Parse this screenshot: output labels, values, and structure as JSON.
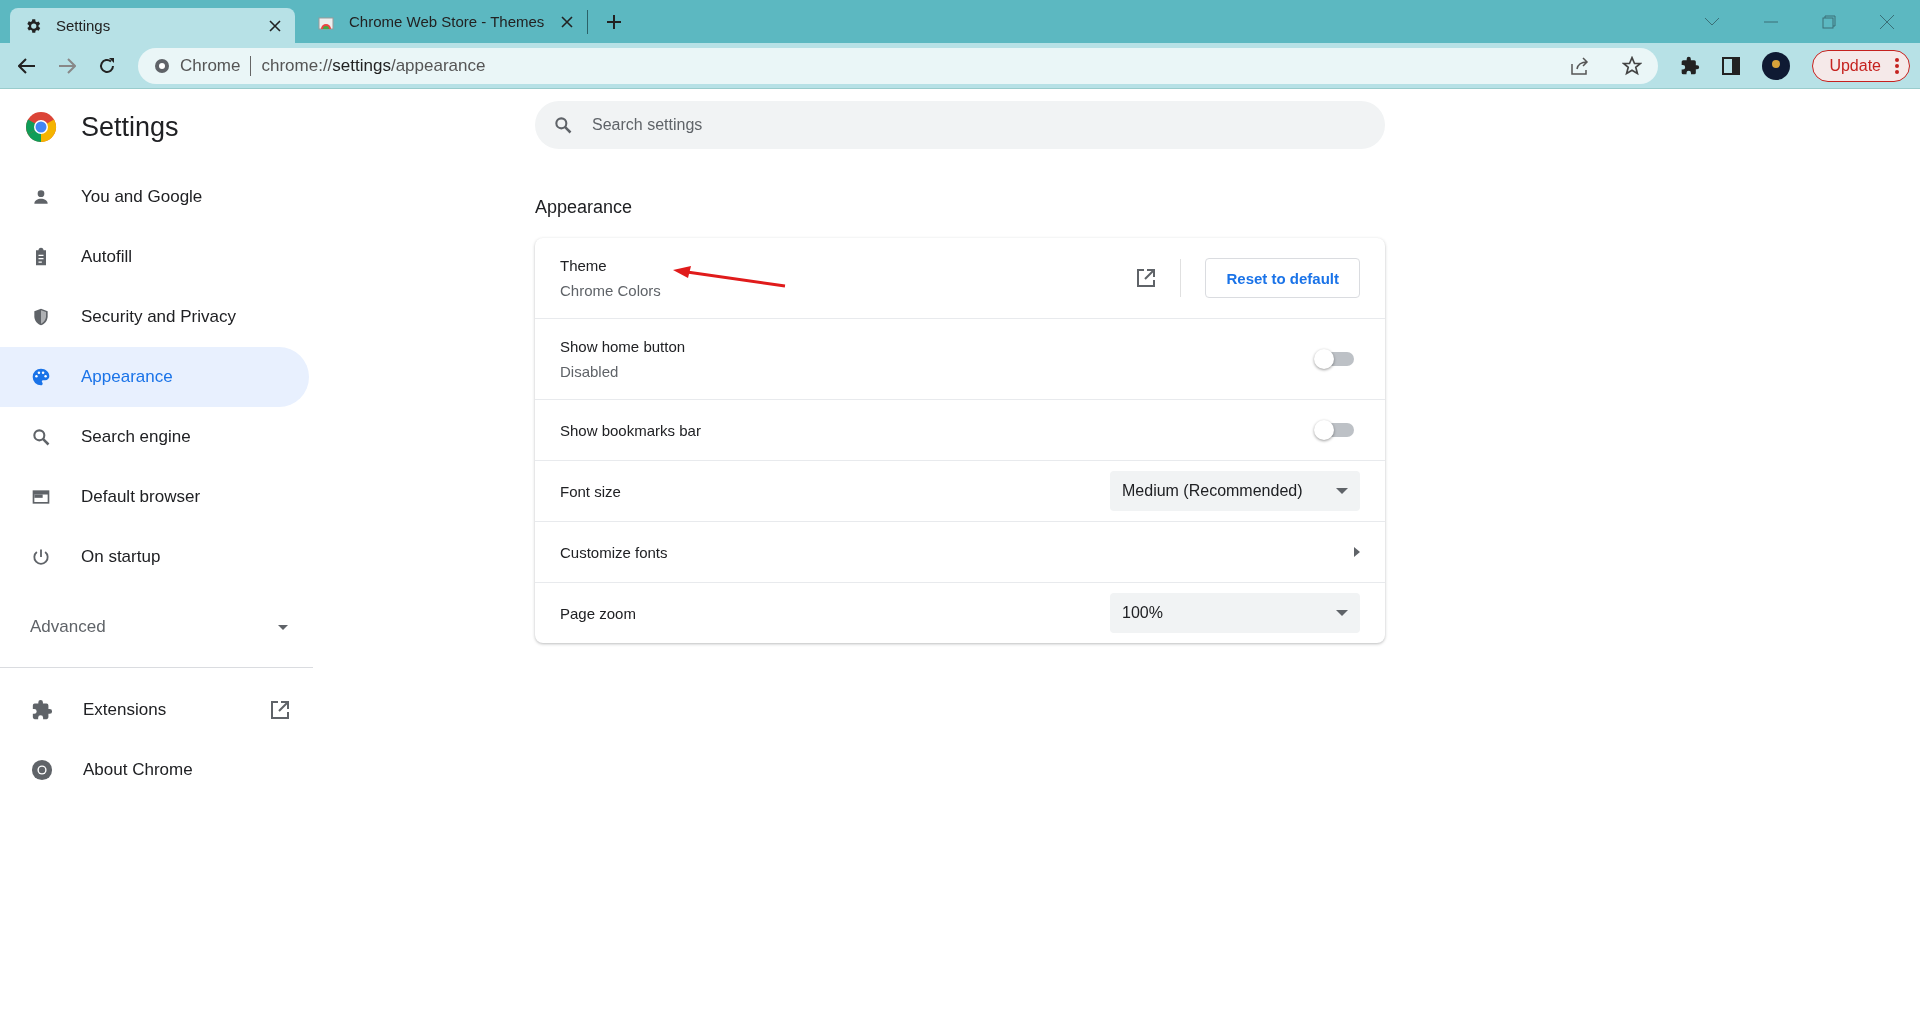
{
  "tabs": [
    {
      "label": "Settings",
      "selected": true
    },
    {
      "label": "Chrome Web Store - Themes",
      "selected": false
    }
  ],
  "address": {
    "origin": "Chrome",
    "url_prefix": "chrome://",
    "url_host": "settings",
    "url_path": "/appearance"
  },
  "update_button": "Update",
  "sidebar": {
    "title": "Settings",
    "items": [
      {
        "label": "You and Google",
        "selected": false
      },
      {
        "label": "Autofill",
        "selected": false
      },
      {
        "label": "Security and Privacy",
        "selected": false
      },
      {
        "label": "Appearance",
        "selected": true
      },
      {
        "label": "Search engine",
        "selected": false
      },
      {
        "label": "Default browser",
        "selected": false
      },
      {
        "label": "On startup",
        "selected": false
      }
    ],
    "advanced": {
      "label": "Advanced",
      "expanded": false
    },
    "bottom_items": [
      {
        "label": "Extensions",
        "external": true
      },
      {
        "label": "About Chrome",
        "external": false
      }
    ]
  },
  "search": {
    "placeholder": "Search settings"
  },
  "section_title": "Appearance",
  "rows": [
    {
      "kind": "link",
      "label": "Theme",
      "sublabel": "Chrome Colors",
      "button": "Reset to default"
    },
    {
      "kind": "toggle",
      "label": "Show home button",
      "sublabel": "Disabled",
      "on": false
    },
    {
      "kind": "toggle",
      "label": "Show bookmarks bar",
      "on": false
    },
    {
      "kind": "select",
      "label": "Font size",
      "value": "Medium (Recommended)"
    },
    {
      "kind": "submenu",
      "label": "Customize fonts"
    },
    {
      "kind": "select",
      "label": "Page zoom",
      "value": "100%"
    }
  ]
}
